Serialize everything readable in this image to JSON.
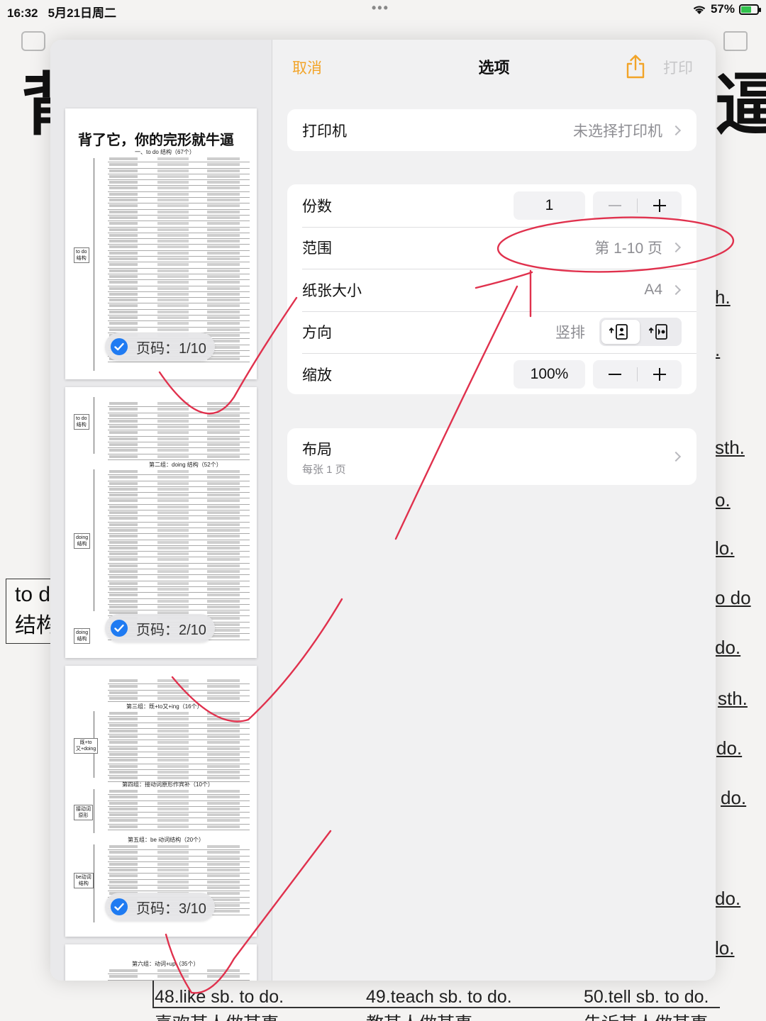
{
  "status_bar": {
    "time": "16:32",
    "date": "5月21日周二",
    "battery": "57%"
  },
  "background_doc": {
    "big_left": "背",
    "big_right": "逼",
    "box_lines": [
      "to d",
      "结构"
    ],
    "right_fragments": [
      "h.",
      ".",
      "sth.",
      "o.",
      "lo.",
      "o do",
      "do.",
      "sth.",
      "do.",
      "do.",
      "do.",
      "lo."
    ],
    "bottom_items": [
      "48.like sb. to do.",
      "49.teach sb. to do.",
      "50.tell sb. to do."
    ],
    "bottom_items_cn": [
      "喜欢某人做某事",
      "教某人做某事",
      "告诉某人做某事"
    ]
  },
  "preview": {
    "doc_title": "背了它，你的完形就牛逼",
    "section_1": "一、to do 结构（67个）",
    "section_2": "第二组：doing 结构（52个）",
    "section_3": "第三组：既+to又+ing（16个）",
    "section_4": "第四组：接动词原形作宾补（10个）",
    "section_5": "第五组：be 动词结构（20个）",
    "section_6": "第六组：动词+up（35个）",
    "tags": {
      "todo": "to do\n结构",
      "doing": "doing\n结构",
      "both": "既+to\n又+doing",
      "base": "接动词\n原形",
      "be": "be动词\n结构"
    },
    "badges": [
      "页码：1/10",
      "页码：2/10",
      "页码：3/10"
    ]
  },
  "header": {
    "cancel": "取消",
    "title": "选项",
    "print": "打印"
  },
  "printer": {
    "label": "打印机",
    "value": "未选择打印机"
  },
  "copies": {
    "label": "份数",
    "value": "1"
  },
  "range": {
    "label": "范围",
    "value": "第 1-10 页"
  },
  "paper": {
    "label": "纸张大小",
    "value": "A4"
  },
  "orientation": {
    "label": "方向",
    "value": "竖排"
  },
  "scale": {
    "label": "缩放",
    "value": "100%"
  },
  "layout": {
    "label": "布局",
    "subtitle": "每张 1 页"
  },
  "colors": {
    "accent": "#f2a428",
    "check": "#1f7bf2",
    "annotation": "#e0314d"
  }
}
